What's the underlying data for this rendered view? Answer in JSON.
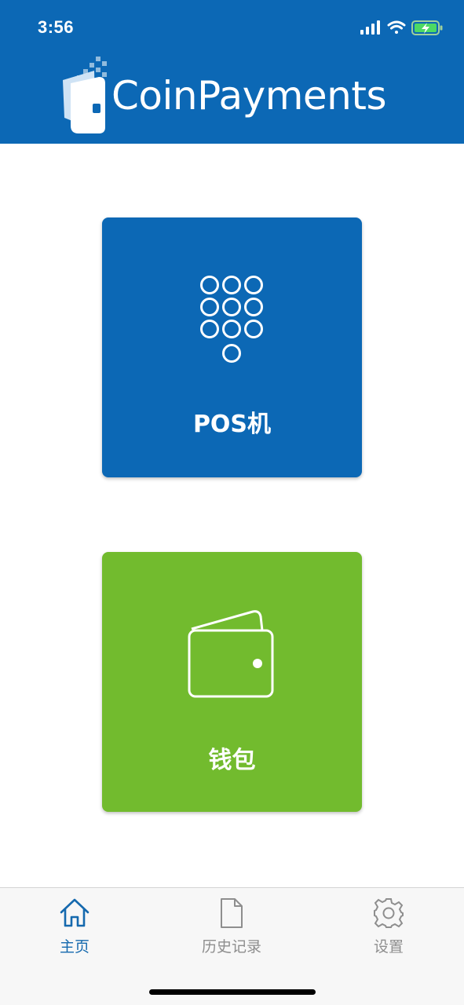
{
  "status_bar": {
    "time": "3:56"
  },
  "header": {
    "brand_name": "CoinPayments"
  },
  "tiles": [
    {
      "label": "POS机",
      "icon": "keypad-icon",
      "color": "#0c68b5"
    },
    {
      "label": "钱包",
      "icon": "wallet-icon",
      "color": "#72bb2e"
    }
  ],
  "tabbar": {
    "items": [
      {
        "label": "主页",
        "icon": "home-icon",
        "active": true
      },
      {
        "label": "历史记录",
        "icon": "document-icon",
        "active": false
      },
      {
        "label": "设置",
        "icon": "gear-icon",
        "active": false
      }
    ]
  },
  "colors": {
    "brand_blue": "#0c68b5",
    "wallet_green": "#72bb2e",
    "tab_active": "#1569ae",
    "tab_inactive": "#8e8e8e"
  }
}
